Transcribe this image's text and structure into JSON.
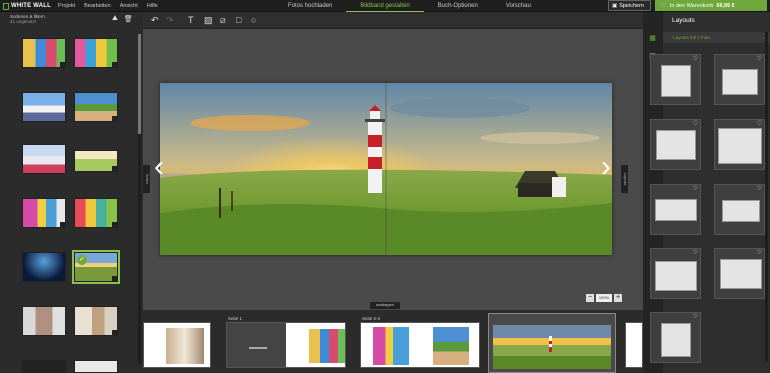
{
  "app": {
    "logo": "WHITE WALL"
  },
  "menu": [
    "Projekt",
    "Bearbeiten",
    "Ansicht",
    "Hilfe"
  ],
  "steps": [
    {
      "label": "Fotos hochladen",
      "active": false
    },
    {
      "label": "Bildband gestalten",
      "active": true
    },
    {
      "label": "Buch-Optionen",
      "active": false
    },
    {
      "label": "Vorschau",
      "active": false
    }
  ],
  "save": {
    "label": "Speichern"
  },
  "cart": {
    "label": "In den Warenkorb",
    "price": "69,95 €"
  },
  "photos": {
    "sort_label": "Sortieren & filtern",
    "sort_sub": "41 ungenutzt",
    "selected_badge": "✓"
  },
  "zoom": {
    "value": "100%",
    "minus": "−",
    "plus": "+"
  },
  "workspace": {
    "expand_label": "ausklappen",
    "left_tab": "Seiten",
    "right_tab": "Layouts"
  },
  "pages": [
    {
      "label": ""
    },
    {
      "label": "Seite 1"
    },
    {
      "label": "Seite 2-3"
    },
    {
      "label": "Seite 4-5"
    }
  ],
  "layouts_panel": {
    "title": "Layouts",
    "accordion": "Layouts mit 1 Foto",
    "chevron": "−",
    "heart": "♡"
  },
  "colors": {
    "accent": "#6fa83a",
    "active_text": "#8ac249"
  }
}
